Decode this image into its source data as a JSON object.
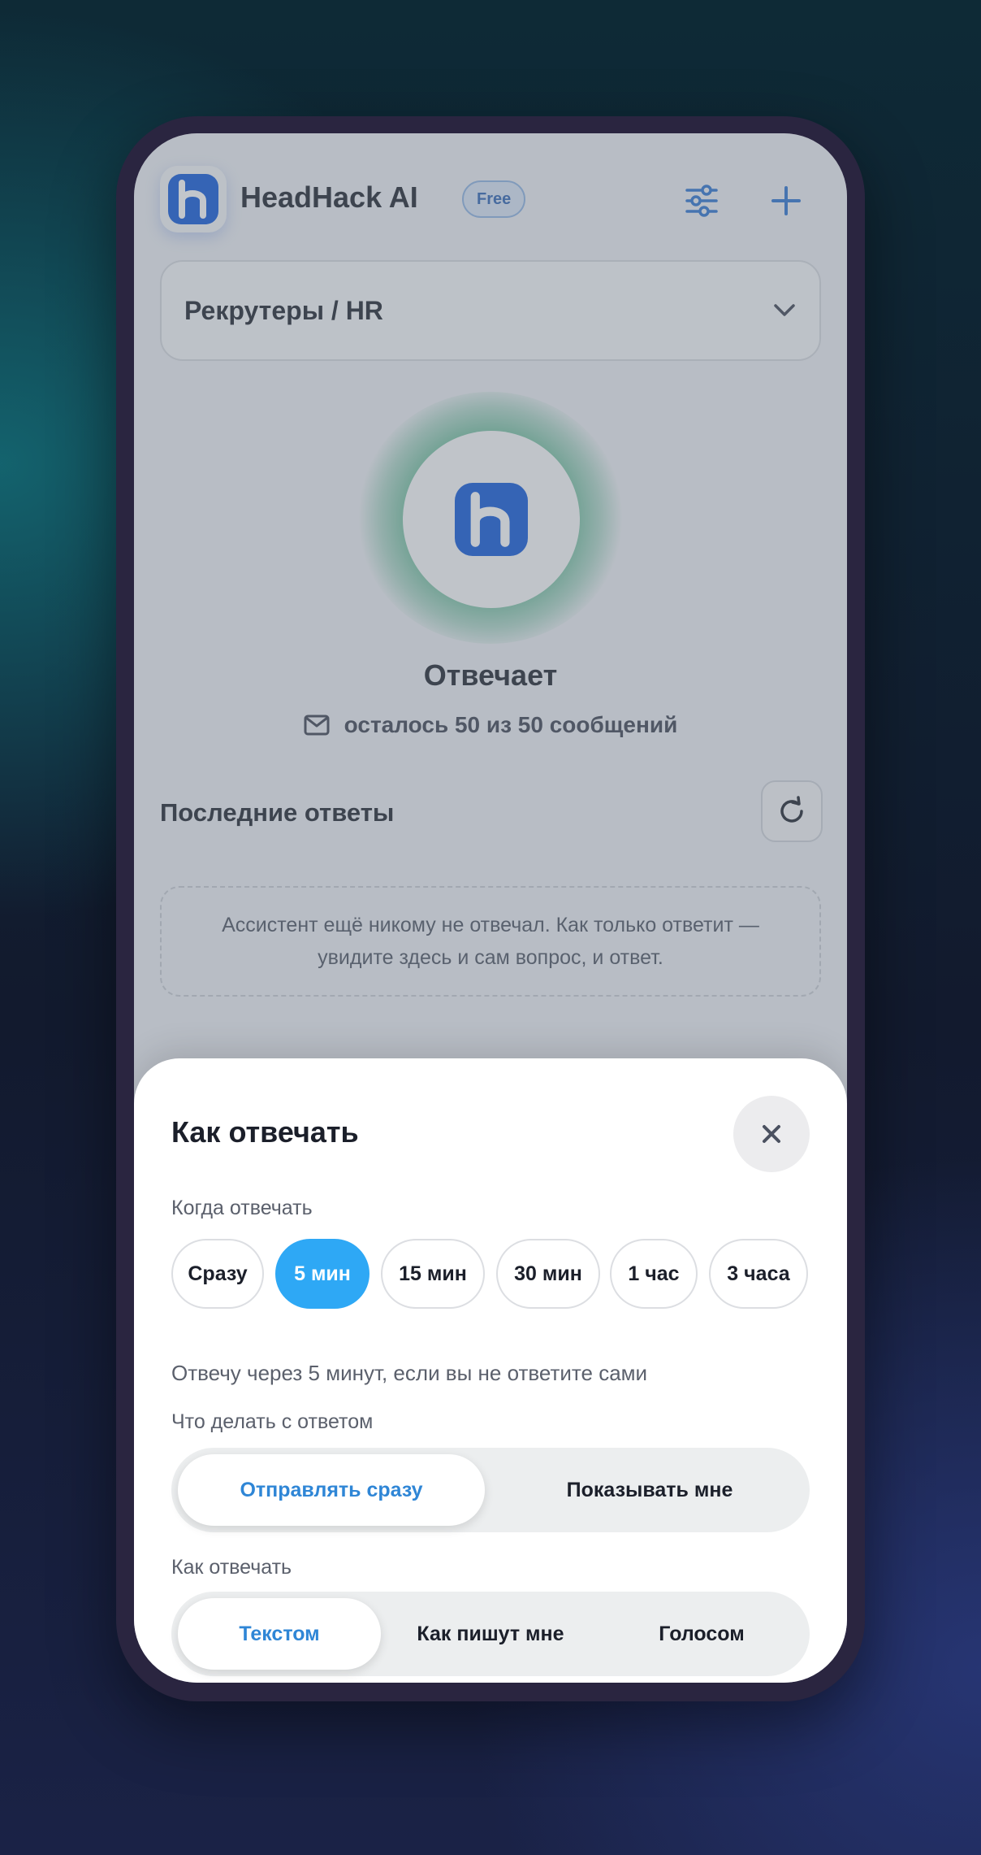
{
  "app": {
    "name": "HeadHack AI",
    "plan_badge": "Free",
    "logo_letter": "h"
  },
  "profile_select": {
    "value": "Рекрутеры / HR"
  },
  "status": {
    "title": "Отвечает",
    "quota": "осталось 50 из 50 сообщений"
  },
  "recent": {
    "title": "Последние ответы",
    "empty_text": "Ассистент ещё никому не отвечал. Как только ответит — увидите здесь и сам вопрос, и ответ."
  },
  "sheet": {
    "title": "Как отвечать",
    "when": {
      "label": "Когда отвечать",
      "options": [
        "Сразу",
        "5 мин",
        "15 мин",
        "30 мин",
        "1 час",
        "3 часа"
      ],
      "selected": "5 мин",
      "hint": "Отвечу через 5 минут, если вы не ответите сами"
    },
    "action": {
      "label": "Что делать с ответом",
      "options": [
        "Отправлять сразу",
        "Показывать мне"
      ],
      "selected": "Отправлять сразу"
    },
    "style": {
      "label": "Как отвечать",
      "options": [
        "Текстом",
        "Как пишут мне",
        "Голосом"
      ],
      "selected": "Текстом"
    }
  },
  "colors": {
    "brand": "#0d56d9",
    "accent": "#2ea8f5",
    "selected_text": "#2f86d6",
    "glow": "#3caa78"
  },
  "icons": [
    "sliders-icon",
    "plus-icon",
    "chevron-down-icon",
    "mail-icon",
    "refresh-icon",
    "close-icon"
  ]
}
